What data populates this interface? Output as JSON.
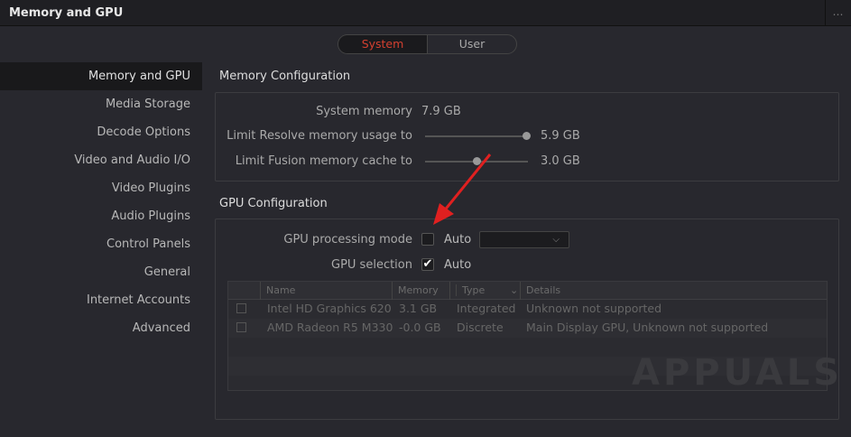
{
  "title": "Memory and GPU",
  "more_icon": "…",
  "tabs": {
    "system": "System",
    "user": "User"
  },
  "sidebar": [
    "Memory and GPU",
    "Media Storage",
    "Decode Options",
    "Video and Audio I/O",
    "Video Plugins",
    "Audio Plugins",
    "Control Panels",
    "General",
    "Internet Accounts",
    "Advanced"
  ],
  "memory": {
    "heading": "Memory Configuration",
    "system_label": "System memory",
    "system_value": "7.9 GB",
    "resolve_label": "Limit Resolve memory usage to",
    "resolve_value": "5.9 GB",
    "resolve_fraction": 0.98,
    "fusion_label": "Limit Fusion memory cache to",
    "fusion_value": "3.0 GB",
    "fusion_fraction": 0.5
  },
  "gpu": {
    "heading": "GPU Configuration",
    "mode_label": "GPU processing mode",
    "mode_auto": "Auto",
    "mode_checked": false,
    "selection_label": "GPU selection",
    "selection_auto": "Auto",
    "selection_checked": true,
    "columns": [
      "Name",
      "Memory",
      "Type",
      "Details"
    ],
    "rows": [
      [
        "Intel HD Graphics 620",
        "3.1 GB",
        "Integrated",
        "Unknown not supported"
      ],
      [
        "AMD Radeon R5 M330",
        "-0.0 GB",
        "Discrete",
        "Main Display GPU, Unknown not supported"
      ]
    ]
  },
  "watermark": "APPUALS",
  "accent": "#d44030"
}
